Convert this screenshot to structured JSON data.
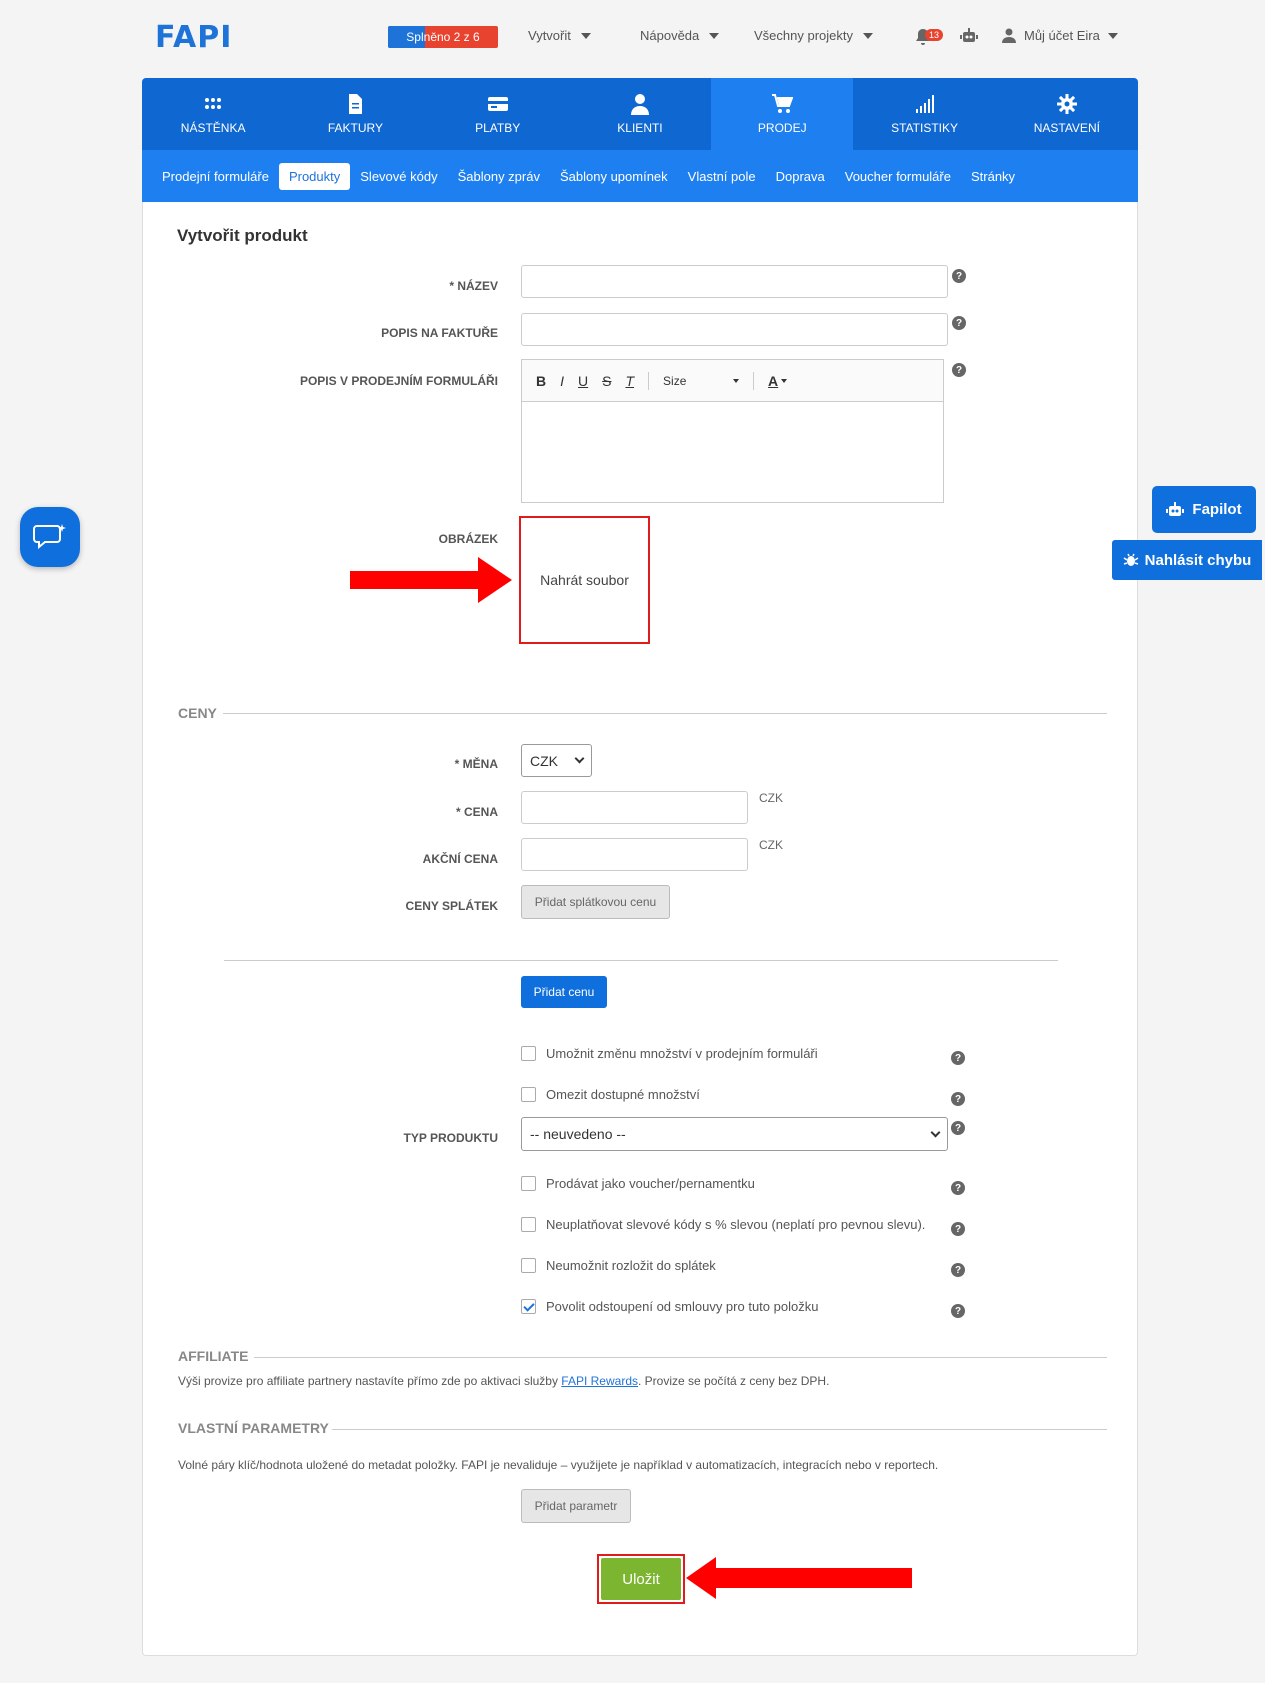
{
  "header": {
    "logo": "FAPI",
    "progress_label": "Splněno 2 z 6",
    "progress_fraction": 0.333,
    "menu": [
      "Vytvořit",
      "Nápověda",
      "Všechny projekty"
    ],
    "notification_count": "13",
    "account_label": "Můj účet Eira"
  },
  "main_nav": [
    {
      "label": "NÁSTĚNKA",
      "icon": "dashboard-icon"
    },
    {
      "label": "FAKTURY",
      "icon": "document-icon"
    },
    {
      "label": "PLATBY",
      "icon": "card-icon"
    },
    {
      "label": "KLIENTI",
      "icon": "user-icon"
    },
    {
      "label": "PRODEJ",
      "icon": "cart-icon"
    },
    {
      "label": "STATISTIKY",
      "icon": "signal-icon"
    },
    {
      "label": "NASTAVENÍ",
      "icon": "gear-icon"
    }
  ],
  "sub_nav": [
    "Prodejní formuláře",
    "Produkty",
    "Slevové kódy",
    "Šablony zpráv",
    "Šablony upomínek",
    "Vlastní pole",
    "Doprava",
    "Voucher formuláře",
    "Stránky"
  ],
  "form": {
    "title": "Vytvořit produkt",
    "name_label": "* NÁZEV",
    "invoice_desc_label": "POPIS NA FAKTUŘE",
    "form_desc_label": "POPIS V PRODEJNÍM FORMULÁŘI",
    "editor": {
      "bold": "B",
      "italic": "I",
      "underline": "U",
      "strike": "S",
      "clear": "T",
      "size": "Size",
      "color": "A"
    },
    "image_label": "OBRÁZEK",
    "upload_label": "Nahrát soubor"
  },
  "prices": {
    "section": "CENY",
    "currency_label": "* MĚNA",
    "currency_value": "CZK",
    "price_label": "* CENA",
    "price_unit": "CZK",
    "sale_price_label": "AKČNÍ CENA",
    "sale_price_unit": "CZK",
    "installments_label": "CENY SPLÁTEK",
    "installments_button": "Přidat splátkovou cenu",
    "add_price_button": "Přidat cenu"
  },
  "options": {
    "allow_quantity": "Umožnit změnu množství v prodejním formuláři",
    "limit_quantity": "Omezit dostupné množství",
    "product_type_label": "TYP PRODUKTU",
    "product_type_value": "-- neuvedeno --",
    "voucher": "Prodávat jako voucher/pernamentku",
    "no_discount": "Neuplatňovat slevové kódy s % slevou (neplatí pro pevnou slevu).",
    "no_installments": "Neumožnit rozložit do splátek",
    "withdrawal": "Povolit odstoupení od smlouvy pro tuto položku"
  },
  "affiliate": {
    "section": "AFFILIATE",
    "text_before": "Výši provize pro affiliate partnery nastavíte přímo zde po aktivaci služby ",
    "link": "FAPI Rewards",
    "text_after": ". Provize se počítá z ceny bez DPH."
  },
  "custom_params": {
    "section": "VLASTNÍ PARAMETRY",
    "text": "Volné páry klíč/hodnota uložené do metadat položky. FAPI je nevaliduje – využijete je například v automatizacích, integracích nebo v reportech.",
    "add_button": "Přidat parametr"
  },
  "save_button": "Uložit",
  "side": {
    "fapilot": "Fapilot",
    "report_bug": "Nahlásit chybu"
  },
  "colors": {
    "primary": "#0f67d1",
    "save": "#7cb52f",
    "highlight": "#e01b1b"
  }
}
